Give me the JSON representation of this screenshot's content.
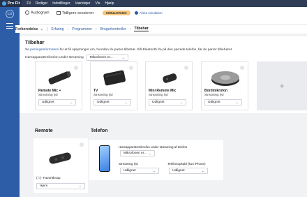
{
  "app": {
    "name": "Pro Fit"
  },
  "menu": [
    "Fil",
    "Rediger",
    "Indstillinger",
    "Værktøjer",
    "Vis",
    "Hjælp"
  ],
  "user": {
    "initials": "CS"
  },
  "toolbar": {
    "audiogram": "Audiogram",
    "previous_sessions": "Tidligere sessioner",
    "simulating": "SIMULERING",
    "stop_simulation": "Afslut simulation"
  },
  "breadcrumb": {
    "items": [
      "Forberedelse",
      "Erfaring",
      "Programmer",
      "Brugerkontroller",
      "Tilbehør"
    ]
  },
  "page": {
    "title": "Tilbehør",
    "intro_prefix": "Se ",
    "intro_link": "parringsinformation",
    "intro_suffix": " for at få oplysninger om, hvordan du parrer tilbehør. Slå Bluetooth fra på den parrede telefon, før du parrer tilbehøret.",
    "streaming_mic_label": "Høreapparatsmikrofon under streaming",
    "streaming_mic_value": "Mikrofonen er..."
  },
  "devices": [
    {
      "name": "Remote Mic +",
      "sub": "Streaming lyd",
      "value": "Udlignet",
      "icon": "remote-mic-icon"
    },
    {
      "name": "TV",
      "sub": "Streaming lyd",
      "value": "Udlignet",
      "icon": "tv-streamer-icon"
    },
    {
      "name": "Mini Remote Mic",
      "sub": "Streaming lyd",
      "value": "Udlignet",
      "icon": "mini-mic-icon"
    },
    {
      "name": "Bordmikrofon",
      "sub": "Streaming lyd",
      "value": "Udlignet",
      "icon": "table-mic-icon"
    }
  ],
  "add": {
    "symbol": "+"
  },
  "remote": {
    "title": "Remote",
    "favorite_label": "Favoritknap",
    "favorite_value": "Hjem"
  },
  "phone": {
    "title": "Telefon",
    "mic_label": "Høreapparatsmikrofon under streaming af telefon",
    "mic_value": "Mikrofonen er...",
    "streaming_label": "Streaming lyd",
    "streaming_value": "Udlignet",
    "call_label": "Telefonopkald (kun iPhone)",
    "call_value": "Udlignet"
  }
}
